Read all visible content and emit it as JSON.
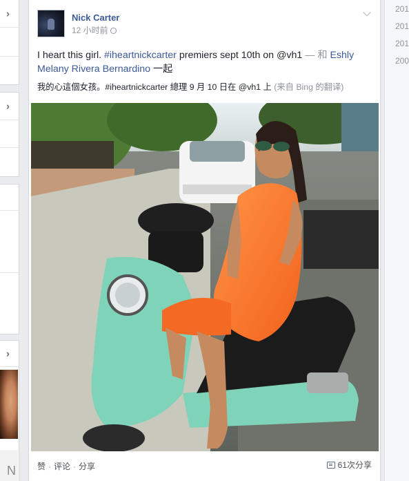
{
  "post": {
    "author": "Nick Carter",
    "timestamp": "12 小时前",
    "privacy_icon": "globe-icon",
    "text": {
      "main": "I heart this girl. ",
      "hashtag": "#iheartnickcarter",
      "middle": " premiers sept 10th on @vh1 ",
      "dash": "— 和 ",
      "tagged": "Eshly Melany Rivera Bernardino",
      "suffix": " 一起"
    },
    "translation": {
      "text": "我的心這個女孩。#iheartnickcarter 總理 9 月 10 日在 @vh1 上 ",
      "source": "(来自 Bing 的翻译)"
    },
    "actions": {
      "like": "赞",
      "comment": "评论",
      "share": "分享",
      "separator": "·"
    },
    "share_count": "61次分享",
    "share_icon": "share-icon"
  },
  "right_rail": {
    "years": [
      "201",
      "201",
      "201",
      "200"
    ]
  },
  "left_rail": {
    "chevron": "›",
    "face_letter": "N"
  },
  "colors": {
    "link": "#3b5998",
    "background": "#e9ebee",
    "dress": "#ff7a2e",
    "scooter": "#7fd3b8"
  }
}
